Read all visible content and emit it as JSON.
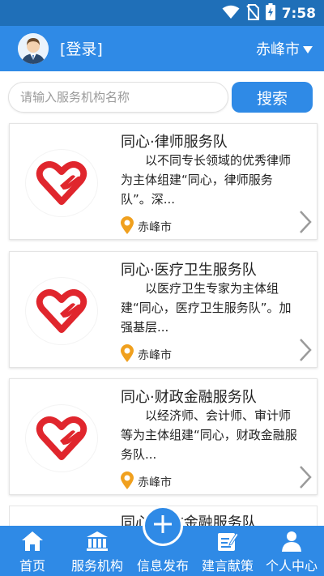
{
  "status_bar": {
    "time": "7:58",
    "icons": [
      "wifi-icon",
      "no-sim-icon",
      "battery-charging-icon"
    ]
  },
  "header": {
    "login_label": "[登录]",
    "city": "赤峰市",
    "city_dropdown_icon": "caret-down-icon"
  },
  "search": {
    "placeholder": "请输入服务机构名称",
    "value": "",
    "button_label": "搜索"
  },
  "cards": [
    {
      "title": "同心·律师服务队",
      "description": "以不同专长领域的优秀律师为主体组建“同心，律师服务队”。深...",
      "location": "赤峰市"
    },
    {
      "title": "同心·医疗卫生服务队",
      "description": "以医疗卫生专家为主体组建“同心，医疗卫生服务队”。加强基层...",
      "location": "赤峰市"
    },
    {
      "title": "同心·财政金融服务队",
      "description": "以经济师、会计师、审计师等为主体组建“同心，财政金融服务队...",
      "location": "赤峰市"
    },
    {
      "title": "同心·财政金融服务队"
    }
  ],
  "bottom_nav": [
    {
      "label": "首页",
      "icon": "home-icon"
    },
    {
      "label": "服务机构",
      "icon": "institution-icon"
    },
    {
      "label": "信息发布",
      "icon": "plus-icon"
    },
    {
      "label": "建言献策",
      "icon": "suggestion-icon"
    },
    {
      "label": "个人中心",
      "icon": "person-icon"
    }
  ],
  "colors": {
    "primary": "#2f8ae6",
    "status_bar": "#1f6fb8",
    "heart": "#e0262d",
    "location_pin": "#f0a01e"
  }
}
